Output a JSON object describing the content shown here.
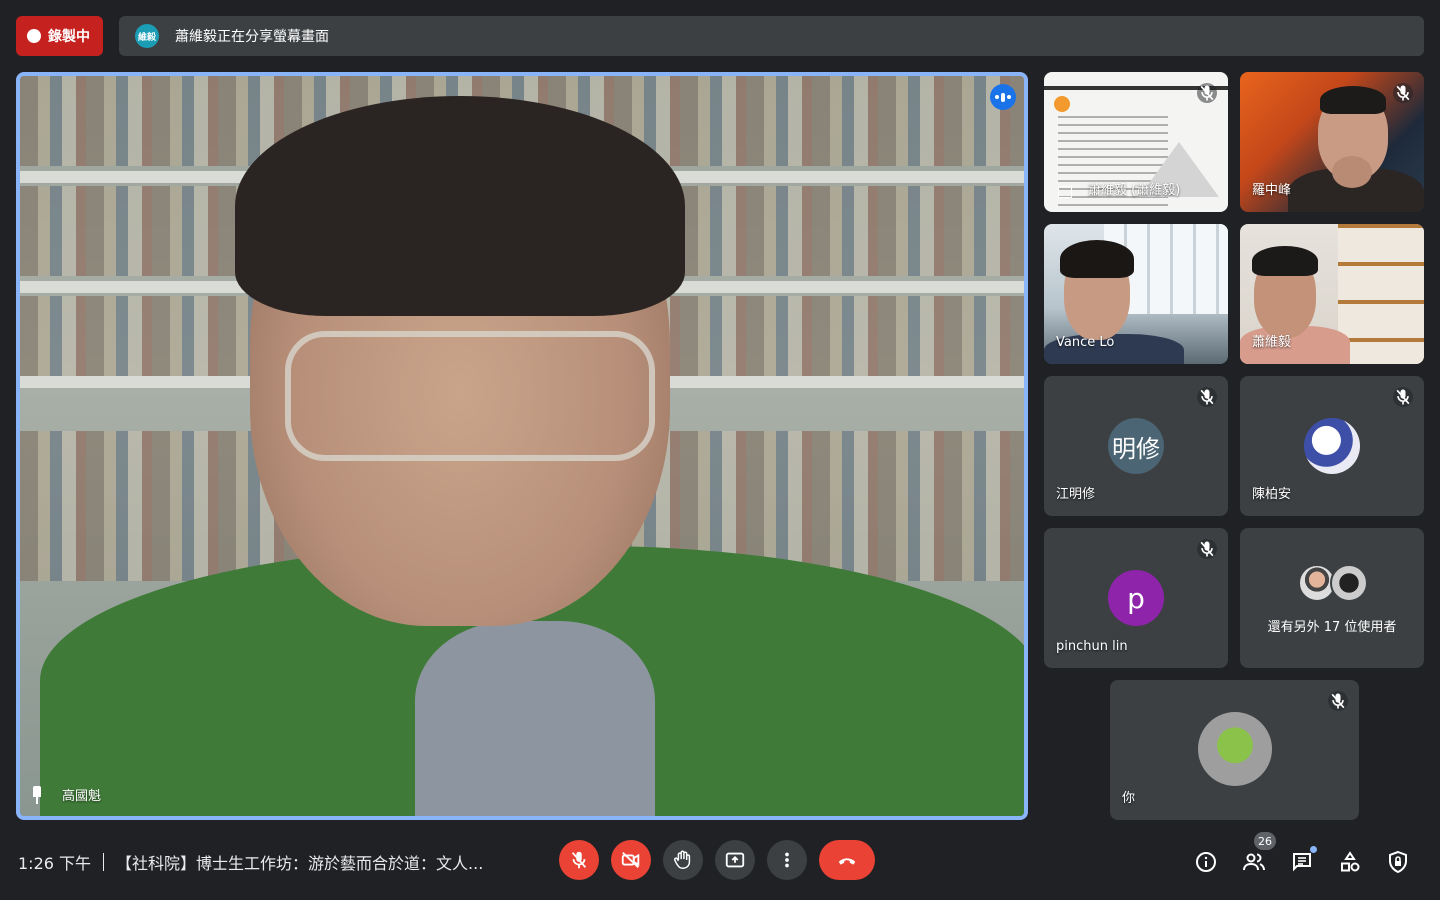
{
  "recording": {
    "label": "錄製中",
    "color": "#c5221f"
  },
  "presentation": {
    "avatar_text": "維毅",
    "text": "蕭維毅正在分享螢幕畫面"
  },
  "main_speaker": {
    "name": "高國魁",
    "pinned": true
  },
  "tiles": [
    {
      "name": "蕭維毅 (蕭維毅)",
      "type": "screen-share",
      "muted": true
    },
    {
      "name": "羅中峰",
      "type": "video",
      "muted": true
    },
    {
      "name": "Vance Lo",
      "type": "video",
      "muted": false
    },
    {
      "name": "蕭維毅",
      "type": "video",
      "muted": false
    },
    {
      "name": "江明修",
      "type": "avatar",
      "avatar_text": "明修",
      "muted": true
    },
    {
      "name": "陳柏安",
      "type": "avatar",
      "muted": true
    },
    {
      "name": "pinchun lin",
      "type": "avatar",
      "avatar_text": "p",
      "muted": true
    },
    {
      "name": "還有另外 17 位使用者",
      "type": "overflow",
      "muted": false
    },
    {
      "name": "你",
      "type": "avatar",
      "muted": true
    }
  ],
  "bottom_bar": {
    "time": "1:26 下午",
    "meeting_title": "【社科院】博士生工作坊：游於藝而合於道：文人...",
    "participants_count": "26",
    "controls": [
      "microphone-off",
      "camera-off",
      "raise-hand",
      "present-screen",
      "more-options",
      "leave-call"
    ],
    "right_controls": [
      "meeting-details",
      "people",
      "chat",
      "activities",
      "host-controls"
    ]
  }
}
